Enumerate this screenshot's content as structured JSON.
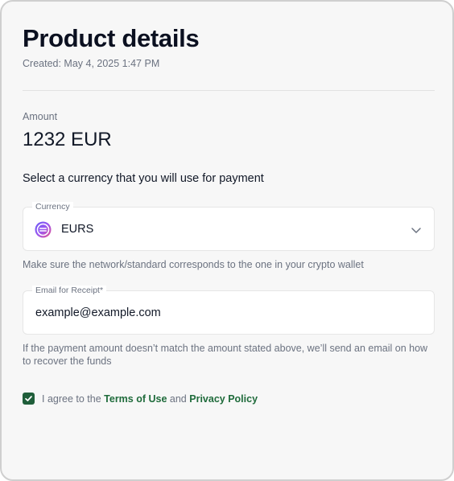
{
  "header": {
    "title": "Product details",
    "created": "Created: May 4, 2025 1:47 PM"
  },
  "amount": {
    "label": "Amount",
    "value": "1232 EUR"
  },
  "currency_section": {
    "heading": "Select a currency that you will use for payment",
    "field_label": "Currency",
    "selected": "EURS",
    "selected_icon": "eurs-coin-icon",
    "hint": "Make sure the network/standard corresponds to the one in your crypto wallet"
  },
  "email_section": {
    "field_label": "Email for Receipt*",
    "value": "example@example.com",
    "hint": "If the payment amount doesn’t match the amount stated above, we’ll send an email on how to recover the funds"
  },
  "agreement": {
    "checked": true,
    "prefix": "I agree to the",
    "terms_link": "Terms of Use",
    "conjunction": "and",
    "privacy_link": "Privacy Policy"
  },
  "colors": {
    "accent_green": "#1f5e3a",
    "link_green": "#1f6b3b",
    "card_bg": "#f7f7f7"
  }
}
